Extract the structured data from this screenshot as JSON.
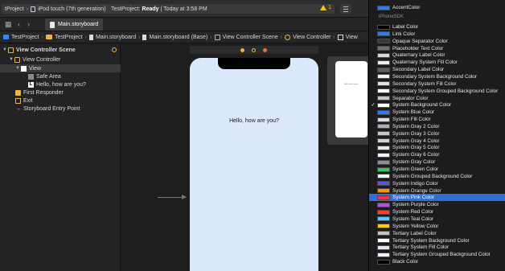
{
  "toolbar": {
    "scheme_project": "tProject",
    "scheme_device": "iPod touch (7th generation)",
    "status_project": "TestProject:",
    "status_state": "Ready",
    "status_time": "| Today at 3:58 PM",
    "warning_count": "1"
  },
  "tabs": [
    {
      "label": "Main.storyboard"
    }
  ],
  "breadcrumb": [
    "TestProject",
    "TestProject",
    "Main.storyboard",
    "Main.storyboard (Base)",
    "View Controller Scene",
    "View Controller",
    "View"
  ],
  "outline": {
    "scene_title": "View Controller Scene",
    "view_controller": "View Controller",
    "view": "View",
    "safe_area": "Safe Area",
    "label": "Hello, how are you?",
    "first_responder": "First Responder",
    "exit": "Exit",
    "entry_point": "Storyboard Entry Point"
  },
  "canvas": {
    "label_text": "Hello, how are you?",
    "mini_label_text": "Hello, how are you?"
  },
  "color_menu": {
    "top_item": {
      "name": "AccentColor",
      "color": "#2f7bf5"
    },
    "section_title": "iPhoneSDK",
    "selected_index": 24,
    "checked_index": 11,
    "items": [
      {
        "name": "Label Color",
        "color": "#000000"
      },
      {
        "name": "Link Color",
        "color": "#2f7bf5"
      },
      {
        "name": "Opaque Separator Color",
        "color": "#3a3a3c"
      },
      {
        "name": "Placeholder Text Color",
        "color": "#6e6e73"
      },
      {
        "name": "Quaternary Label Color",
        "color": "#d9d9db"
      },
      {
        "name": "Quaternary System Fill Color",
        "color": "#eeeeef"
      },
      {
        "name": "Secondary Label Color",
        "color": "#5e5e63"
      },
      {
        "name": "Secondary System Background Color",
        "color": "#f2f2f7"
      },
      {
        "name": "Secondary System Fill Color",
        "color": "#e0e0e5"
      },
      {
        "name": "Secondary System Grouped Background Color",
        "color": "#ffffff"
      },
      {
        "name": "Separator Color",
        "color": "#c6c6c8"
      },
      {
        "name": "System Background Color",
        "color": "#ffffff"
      },
      {
        "name": "System Blue Color",
        "color": "#2f7bf5"
      },
      {
        "name": "System Fill Color",
        "color": "#dcdce0"
      },
      {
        "name": "System Gray 2 Color",
        "color": "#aeaeb2"
      },
      {
        "name": "System Gray 3 Color",
        "color": "#c7c7cc"
      },
      {
        "name": "System Gray 4 Color",
        "color": "#d1d1d6"
      },
      {
        "name": "System Gray 5 Color",
        "color": "#e5e5ea"
      },
      {
        "name": "System Gray 6 Color",
        "color": "#f2f2f7"
      },
      {
        "name": "System Gray Color",
        "color": "#8e8e93"
      },
      {
        "name": "System Green Color",
        "color": "#34c759"
      },
      {
        "name": "System Grouped Background Color",
        "color": "#f2f2f7"
      },
      {
        "name": "System Indigo Color",
        "color": "#5856d6"
      },
      {
        "name": "System Orange Color",
        "color": "#ff9500"
      },
      {
        "name": "System Pink Color",
        "color": "#ff2d55"
      },
      {
        "name": "System Purple Color",
        "color": "#af52de"
      },
      {
        "name": "System Red Color",
        "color": "#ff3b30"
      },
      {
        "name": "System Teal Color",
        "color": "#5ac8fa"
      },
      {
        "name": "System Yellow Color",
        "color": "#ffcc00"
      },
      {
        "name": "Tertiary Label Color",
        "color": "#c4c4c6"
      },
      {
        "name": "Tertiary System Background Color",
        "color": "#ffffff"
      },
      {
        "name": "Tertiary System Fill Color",
        "color": "#e6e6ea"
      },
      {
        "name": "Tertiary System Grouped Background Color",
        "color": "#f2f2f7"
      },
      {
        "name": "Black Color",
        "color": "#000000"
      }
    ]
  }
}
